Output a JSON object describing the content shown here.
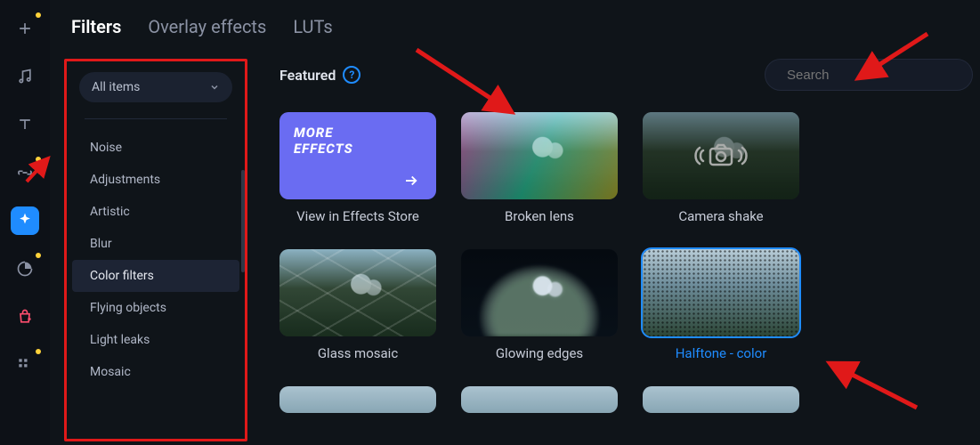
{
  "tabs": {
    "filters": "Filters",
    "overlay": "Overlay effects",
    "luts": "LUTs"
  },
  "dropdown_label": "All items",
  "categories": [
    "Noise",
    "Adjustments",
    "Artistic",
    "Blur",
    "Color filters",
    "Flying objects",
    "Light leaks",
    "Mosaic"
  ],
  "active_category_index": 4,
  "featured_label": "Featured",
  "search": {
    "placeholder": "Search"
  },
  "more_effects": {
    "line1": "MORE",
    "line2": "EFFECTS",
    "caption": "View in Effects Store"
  },
  "cells": {
    "broken_lens": "Broken lens",
    "camera_shake": "Camera shake",
    "glass_mosaic": "Glass mosaic",
    "glowing_edges": "Glowing edges",
    "halftone_color": "Halftone - color"
  },
  "selected_cell": "halftone_color",
  "rail_icons": [
    "plus",
    "music",
    "text",
    "link",
    "sparkle",
    "moon",
    "bag",
    "grid"
  ],
  "active_rail_index": 4,
  "annotation_color": "#e01919"
}
